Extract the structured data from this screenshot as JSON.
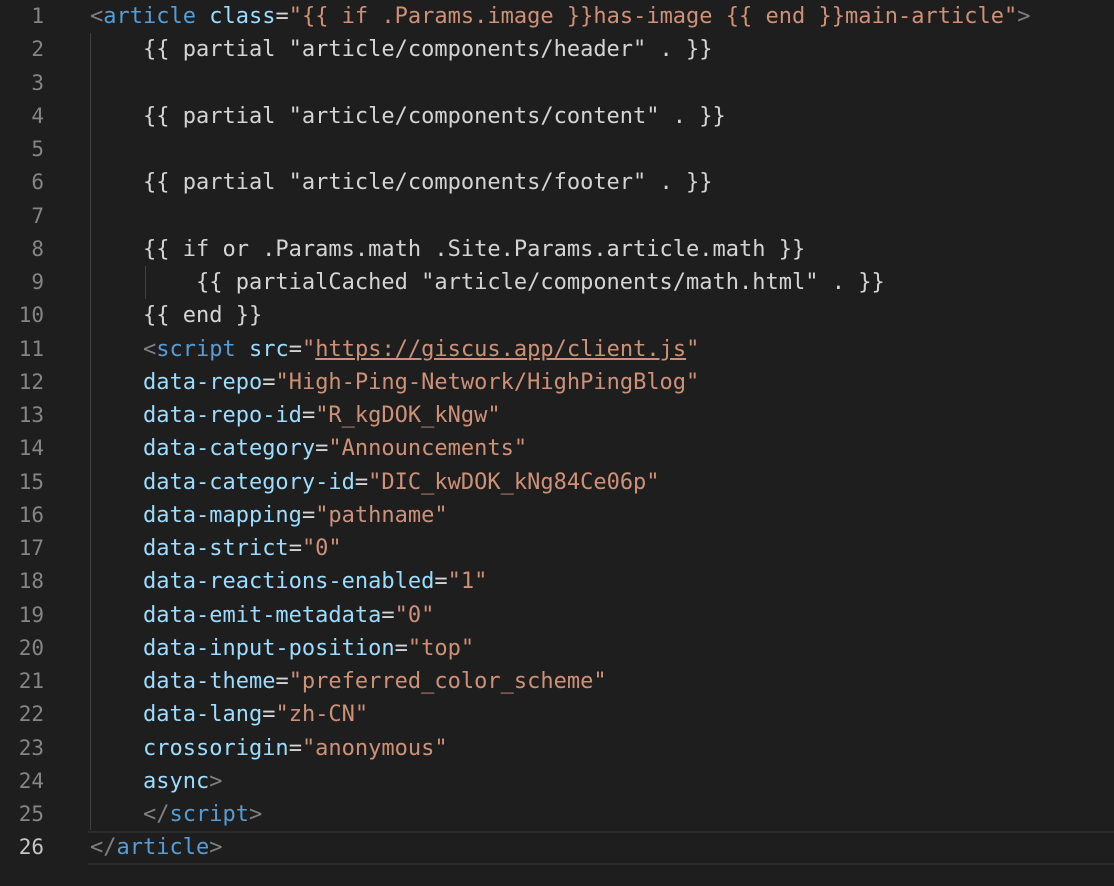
{
  "editor": {
    "language": "html (Go template)",
    "active_line": 26,
    "colors": {
      "background": "#1e1e1e",
      "tag": "#569cd6",
      "attribute": "#9cdcfe",
      "string": "#ce9178",
      "bracket": "#808080",
      "text": "#d4d4d4",
      "line_number": "#858585",
      "line_number_active": "#c6c6c6"
    },
    "lines": [
      {
        "num": "1",
        "tokens": [
          {
            "t": "<",
            "c": "bracket"
          },
          {
            "t": "article",
            "c": "tag"
          },
          {
            "t": " ",
            "c": "plain"
          },
          {
            "t": "class",
            "c": "attr"
          },
          {
            "t": "=",
            "c": "eq"
          },
          {
            "t": "\"{{ if .Params.image }}has-image {{ end }}main-article\"",
            "c": "str"
          },
          {
            "t": ">",
            "c": "bracket"
          }
        ]
      },
      {
        "num": "2",
        "tokens": [
          {
            "t": "    {{ partial \"article/components/header\" . }}",
            "c": "plain"
          }
        ]
      },
      {
        "num": "3",
        "tokens": []
      },
      {
        "num": "4",
        "tokens": [
          {
            "t": "    {{ partial \"article/components/content\" . }}",
            "c": "plain"
          }
        ]
      },
      {
        "num": "5",
        "tokens": []
      },
      {
        "num": "6",
        "tokens": [
          {
            "t": "    {{ partial \"article/components/footer\" . }}",
            "c": "plain"
          }
        ]
      },
      {
        "num": "7",
        "tokens": []
      },
      {
        "num": "8",
        "tokens": [
          {
            "t": "    {{ if or .Params.math .Site.Params.article.math }}",
            "c": "plain"
          }
        ]
      },
      {
        "num": "9",
        "tokens": [
          {
            "t": "        {{ partialCached \"article/components/math.html\" . }}",
            "c": "plain"
          }
        ]
      },
      {
        "num": "10",
        "tokens": [
          {
            "t": "    {{ end }}",
            "c": "plain"
          }
        ]
      },
      {
        "num": "11",
        "tokens": [
          {
            "t": "    ",
            "c": "plain"
          },
          {
            "t": "<",
            "c": "bracket"
          },
          {
            "t": "script",
            "c": "tag"
          },
          {
            "t": " ",
            "c": "plain"
          },
          {
            "t": "src",
            "c": "attr"
          },
          {
            "t": "=",
            "c": "eq"
          },
          {
            "t": "\"",
            "c": "str"
          },
          {
            "t": "https://giscus.app/client.js",
            "c": "link"
          },
          {
            "t": "\"",
            "c": "str"
          }
        ]
      },
      {
        "num": "12",
        "tokens": [
          {
            "t": "    ",
            "c": "plain"
          },
          {
            "t": "data-repo",
            "c": "attr"
          },
          {
            "t": "=",
            "c": "eq"
          },
          {
            "t": "\"High-Ping-Network/HighPingBlog\"",
            "c": "str"
          }
        ]
      },
      {
        "num": "13",
        "tokens": [
          {
            "t": "    ",
            "c": "plain"
          },
          {
            "t": "data-repo-id",
            "c": "attr"
          },
          {
            "t": "=",
            "c": "eq"
          },
          {
            "t": "\"R_kgDOK_kNgw\"",
            "c": "str"
          }
        ]
      },
      {
        "num": "14",
        "tokens": [
          {
            "t": "    ",
            "c": "plain"
          },
          {
            "t": "data-category",
            "c": "attr"
          },
          {
            "t": "=",
            "c": "eq"
          },
          {
            "t": "\"Announcements\"",
            "c": "str"
          }
        ]
      },
      {
        "num": "15",
        "tokens": [
          {
            "t": "    ",
            "c": "plain"
          },
          {
            "t": "data-category-id",
            "c": "attr"
          },
          {
            "t": "=",
            "c": "eq"
          },
          {
            "t": "\"DIC_kwDOK_kNg84Ce06p\"",
            "c": "str"
          }
        ]
      },
      {
        "num": "16",
        "tokens": [
          {
            "t": "    ",
            "c": "plain"
          },
          {
            "t": "data-mapping",
            "c": "attr"
          },
          {
            "t": "=",
            "c": "eq"
          },
          {
            "t": "\"pathname\"",
            "c": "str"
          }
        ]
      },
      {
        "num": "17",
        "tokens": [
          {
            "t": "    ",
            "c": "plain"
          },
          {
            "t": "data-strict",
            "c": "attr"
          },
          {
            "t": "=",
            "c": "eq"
          },
          {
            "t": "\"0\"",
            "c": "str"
          }
        ]
      },
      {
        "num": "18",
        "tokens": [
          {
            "t": "    ",
            "c": "plain"
          },
          {
            "t": "data-reactions-enabled",
            "c": "attr"
          },
          {
            "t": "=",
            "c": "eq"
          },
          {
            "t": "\"1\"",
            "c": "str"
          }
        ]
      },
      {
        "num": "19",
        "tokens": [
          {
            "t": "    ",
            "c": "plain"
          },
          {
            "t": "data-emit-metadata",
            "c": "attr"
          },
          {
            "t": "=",
            "c": "eq"
          },
          {
            "t": "\"0\"",
            "c": "str"
          }
        ]
      },
      {
        "num": "20",
        "tokens": [
          {
            "t": "    ",
            "c": "plain"
          },
          {
            "t": "data-input-position",
            "c": "attr"
          },
          {
            "t": "=",
            "c": "eq"
          },
          {
            "t": "\"top\"",
            "c": "str"
          }
        ]
      },
      {
        "num": "21",
        "tokens": [
          {
            "t": "    ",
            "c": "plain"
          },
          {
            "t": "data-theme",
            "c": "attr"
          },
          {
            "t": "=",
            "c": "eq"
          },
          {
            "t": "\"preferred_color_scheme\"",
            "c": "str"
          }
        ]
      },
      {
        "num": "22",
        "tokens": [
          {
            "t": "    ",
            "c": "plain"
          },
          {
            "t": "data-lang",
            "c": "attr"
          },
          {
            "t": "=",
            "c": "eq"
          },
          {
            "t": "\"zh-CN\"",
            "c": "str"
          }
        ]
      },
      {
        "num": "23",
        "tokens": [
          {
            "t": "    ",
            "c": "plain"
          },
          {
            "t": "crossorigin",
            "c": "attr"
          },
          {
            "t": "=",
            "c": "eq"
          },
          {
            "t": "\"anonymous\"",
            "c": "str"
          }
        ]
      },
      {
        "num": "24",
        "tokens": [
          {
            "t": "    ",
            "c": "plain"
          },
          {
            "t": "async",
            "c": "attr"
          },
          {
            "t": ">",
            "c": "bracket"
          }
        ]
      },
      {
        "num": "25",
        "tokens": [
          {
            "t": "    ",
            "c": "plain"
          },
          {
            "t": "</",
            "c": "bracket"
          },
          {
            "t": "script",
            "c": "tag"
          },
          {
            "t": ">",
            "c": "bracket"
          }
        ]
      },
      {
        "num": "26",
        "tokens": [
          {
            "t": "</",
            "c": "bracket"
          },
          {
            "t": "article",
            "c": "tag"
          },
          {
            "t": ">",
            "c": "bracket"
          }
        ]
      }
    ]
  }
}
